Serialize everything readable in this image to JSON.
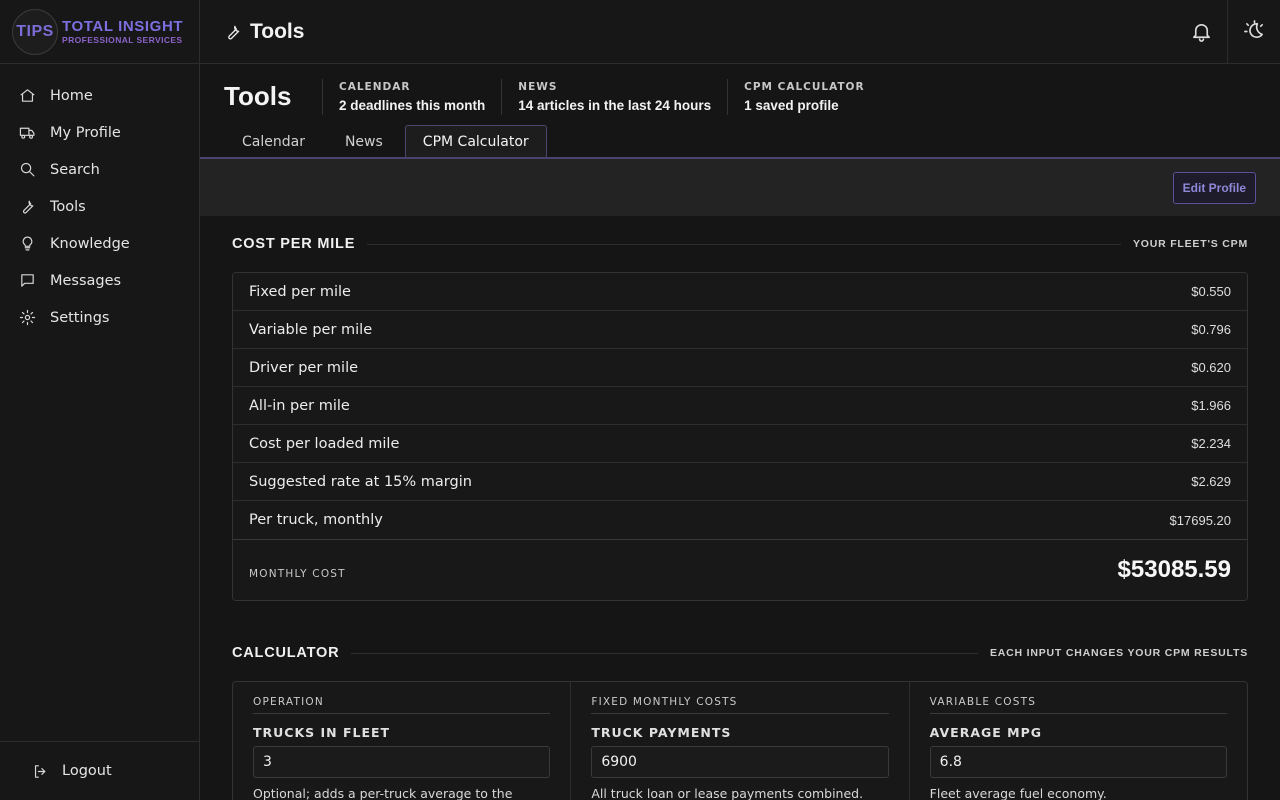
{
  "brand": {
    "badge": "TIPS",
    "title": "TOTAL INSIGHT",
    "subtitle": "PROFESSIONAL SERVICES"
  },
  "sidebar": {
    "items": [
      {
        "label": "Home",
        "icon": "home-icon"
      },
      {
        "label": "My Profile",
        "icon": "truck-icon"
      },
      {
        "label": "Search",
        "icon": "search-icon"
      },
      {
        "label": "Tools",
        "icon": "wrench-icon"
      },
      {
        "label": "Knowledge",
        "icon": "lightbulb-icon"
      },
      {
        "label": "Messages",
        "icon": "message-icon"
      },
      {
        "label": "Settings",
        "icon": "gear-icon"
      }
    ],
    "logout": "Logout"
  },
  "topbar": {
    "title": "Tools"
  },
  "header": {
    "title": "Tools",
    "stats": [
      {
        "label": "CALENDAR",
        "value": "2 deadlines this month"
      },
      {
        "label": "NEWS",
        "value": "14 articles in the last 24 hours"
      },
      {
        "label": "CPM CALCULATOR",
        "value": "1 saved profile"
      }
    ]
  },
  "tabs": [
    {
      "label": "Calendar",
      "active": false
    },
    {
      "label": "News",
      "active": false
    },
    {
      "label": "CPM Calculator",
      "active": true
    }
  ],
  "toolbar": {
    "edit_label": "Edit Profile"
  },
  "cpm": {
    "title": "COST PER MILE",
    "note": "YOUR FLEET'S CPM",
    "rows": [
      {
        "label": "Fixed per mile",
        "value": "$0.550"
      },
      {
        "label": "Variable per mile",
        "value": "$0.796"
      },
      {
        "label": "Driver per mile",
        "value": "$0.620"
      },
      {
        "label": "All-in per mile",
        "value": "$1.966"
      },
      {
        "label": "Cost per loaded mile",
        "value": "$2.234"
      },
      {
        "label": "Suggested rate at 15% margin",
        "value": "$2.629"
      },
      {
        "label": "Per truck, monthly",
        "value": "$17695.20"
      }
    ],
    "total_label": "MONTHLY COST",
    "total_value": "$53085.59"
  },
  "calculator": {
    "title": "CALCULATOR",
    "note": "EACH INPUT CHANGES YOUR CPM RESULTS",
    "columns": [
      {
        "heading": "OPERATION",
        "field_label": "TRUCKS IN FLEET",
        "value": "3",
        "help": "Optional; adds a per-truck average to the results."
      },
      {
        "heading": "FIXED MONTHLY COSTS",
        "field_label": "TRUCK PAYMENTS",
        "value": "6900",
        "help": "All truck loan or lease payments combined."
      },
      {
        "heading": "VARIABLE COSTS",
        "field_label": "AVERAGE MPG",
        "value": "6.8",
        "help": "Fleet average fuel economy."
      }
    ]
  }
}
